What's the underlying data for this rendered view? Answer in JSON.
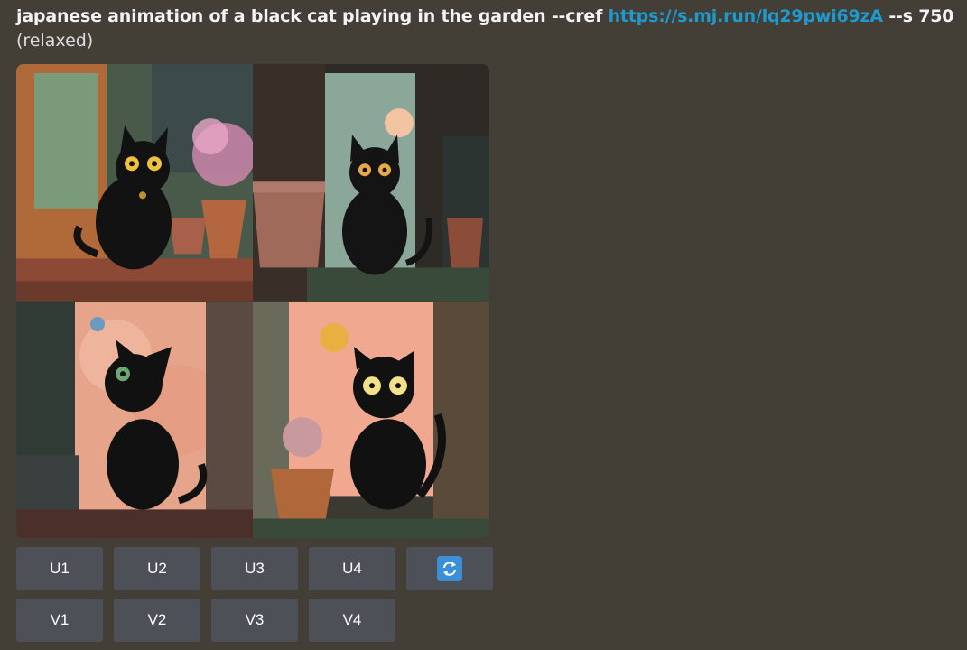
{
  "message": {
    "prompt_text": "japanese animation of a black cat playing in the garden --cref ",
    "prompt_link": "https://s.mj.run/lq29pwi69zA",
    "prompt_suffix": " --s 750",
    "mode": "(relaxed)"
  },
  "image_grid": {
    "tiles": [
      "cat-image-1",
      "cat-image-2",
      "cat-image-3",
      "cat-image-4"
    ]
  },
  "buttons": {
    "upscale": [
      "U1",
      "U2",
      "U3",
      "U4"
    ],
    "variation": [
      "V1",
      "V2",
      "V3",
      "V4"
    ],
    "reroll_icon": "refresh-icon"
  },
  "colors": {
    "background": "#433e36",
    "link": "#1d9bd1",
    "button": "#4e5058",
    "reroll": "#3b8fd6"
  }
}
